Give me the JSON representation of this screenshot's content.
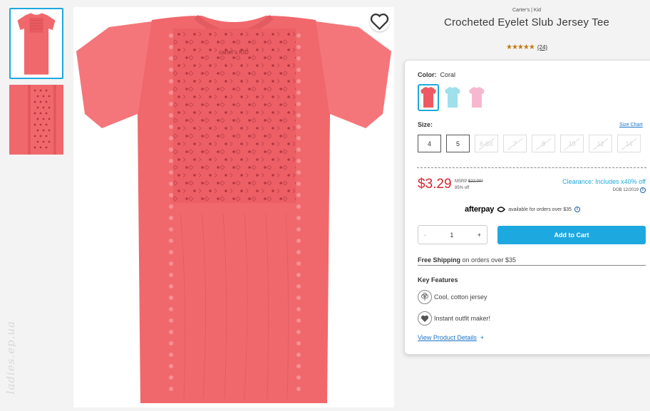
{
  "header": {
    "brand": "Carter's | Kid",
    "title": "Crocheted Eyelet Slub Jersey Tee",
    "stars": "★★★★★",
    "rating_count": "(24)"
  },
  "gallery": {
    "thumbnails": [
      "thumbnail-front",
      "thumbnail-detail"
    ],
    "tag_text": "carter's KID"
  },
  "watermark": "ladies.ep.ua",
  "color": {
    "label": "Color:",
    "selected": "Coral",
    "swatches": [
      {
        "name": "Coral",
        "hex": "#ee5a62"
      },
      {
        "name": "Aqua",
        "hex": "#9fe0ec"
      },
      {
        "name": "Pink",
        "hex": "#f6b8cf"
      }
    ]
  },
  "size": {
    "label": "Size:",
    "chart_link": "Size Chart",
    "options": [
      {
        "label": "4",
        "available": true
      },
      {
        "label": "5",
        "available": true
      },
      {
        "label": "6-6X",
        "available": false
      },
      {
        "label": "7",
        "available": false
      },
      {
        "label": "8",
        "available": false
      },
      {
        "label": "10",
        "available": false
      },
      {
        "label": "12",
        "available": false
      },
      {
        "label": "14",
        "available": false
      }
    ]
  },
  "pricing": {
    "price": "$3.29",
    "msrp_label": "MSRP",
    "msrp": "$22.00*",
    "discount": "85% off",
    "clearance": "Clearance: Includes x40% off",
    "dob": "DOB 12/2019"
  },
  "afterpay": {
    "logo": "afterpay",
    "text": "available for orders over $35"
  },
  "purchase": {
    "qty_minus": "-",
    "qty_value": "1",
    "qty_plus": "+",
    "add_to_cart": "Add to Cart"
  },
  "shipping": {
    "bold": "Free Shipping",
    "rest": " on orders over $35"
  },
  "features": {
    "title": "Key Features",
    "items": [
      {
        "text": "Cool, cotton jersey",
        "icon": "cotton-icon"
      },
      {
        "text": "Instant outfit maker!",
        "icon": "heart-badge-icon"
      }
    ],
    "details_link": "View Product Details",
    "details_plus": "+"
  },
  "colors": {
    "accent": "#1ea8e0",
    "price": "#d8262e",
    "shirt": "#f0686c",
    "link": "#1a73c8"
  }
}
